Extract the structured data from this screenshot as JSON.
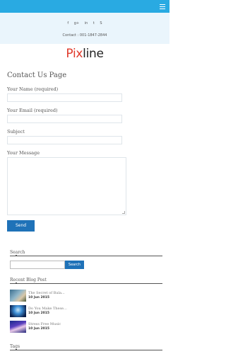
{
  "header": {
    "social_icons": [
      {
        "name": "facebook-icon",
        "glyph": "f"
      },
      {
        "name": "google-plus-icon",
        "glyph": "g+"
      },
      {
        "name": "linkedin-icon",
        "glyph": "in"
      },
      {
        "name": "twitter-icon",
        "glyph": "t"
      },
      {
        "name": "skype-icon",
        "glyph": "S"
      }
    ],
    "contact_line": "Contact : 001-1847-2844"
  },
  "logo": {
    "part1": "Pix",
    "part2": "line"
  },
  "page": {
    "title": "Contact Us Page",
    "fields": {
      "name_label": "Your Name (required)",
      "email_label": "Your Email (required)",
      "subject_label": "Subject",
      "message_label": "Your Message"
    },
    "send_label": "Send"
  },
  "sidebar": {
    "search": {
      "title": "Search",
      "button_label": "Search"
    },
    "recent_posts": {
      "title": "Recent Blog Post",
      "items": [
        {
          "title": "The Secret of Bala...",
          "date": "10 Jun 2015"
        },
        {
          "title": "Do You Make These...",
          "date": "10 Jun 2015"
        },
        {
          "title": "Stress Free Music",
          "date": "10 Jun 2015"
        }
      ]
    },
    "tags": {
      "title": "Tags"
    }
  },
  "colors": {
    "accent": "#29aae2",
    "button": "#1f72b8",
    "logo_red": "#e03a2b"
  }
}
